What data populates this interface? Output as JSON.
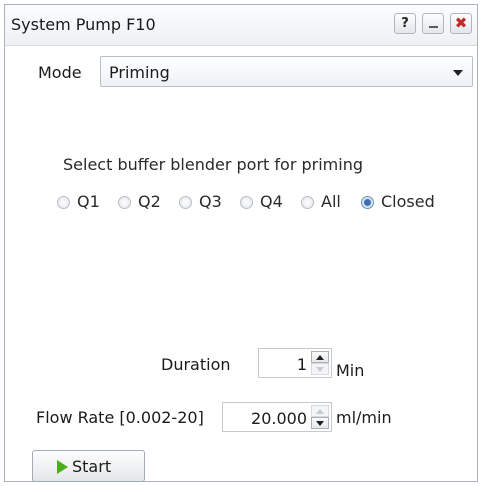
{
  "window": {
    "title": "System Pump F10",
    "help_label": "?",
    "close_label": "✖"
  },
  "mode": {
    "label": "Mode",
    "selected": "Priming"
  },
  "priming": {
    "prompt": "Select buffer blender port for priming",
    "options": [
      "Q1",
      "Q2",
      "Q3",
      "Q4",
      "All",
      "Closed"
    ],
    "selected": "Closed"
  },
  "duration": {
    "label": "Duration",
    "value": "1",
    "unit": "Min"
  },
  "flow_rate": {
    "label": "Flow Rate [0.002-20]",
    "value": "20.000",
    "unit": "ml/min"
  },
  "start": {
    "label": "Start",
    "icon": "play-icon",
    "icon_color": "#4caf1a"
  },
  "colors": {
    "accent": "#3d6fb0",
    "close_red": "#c62828"
  }
}
